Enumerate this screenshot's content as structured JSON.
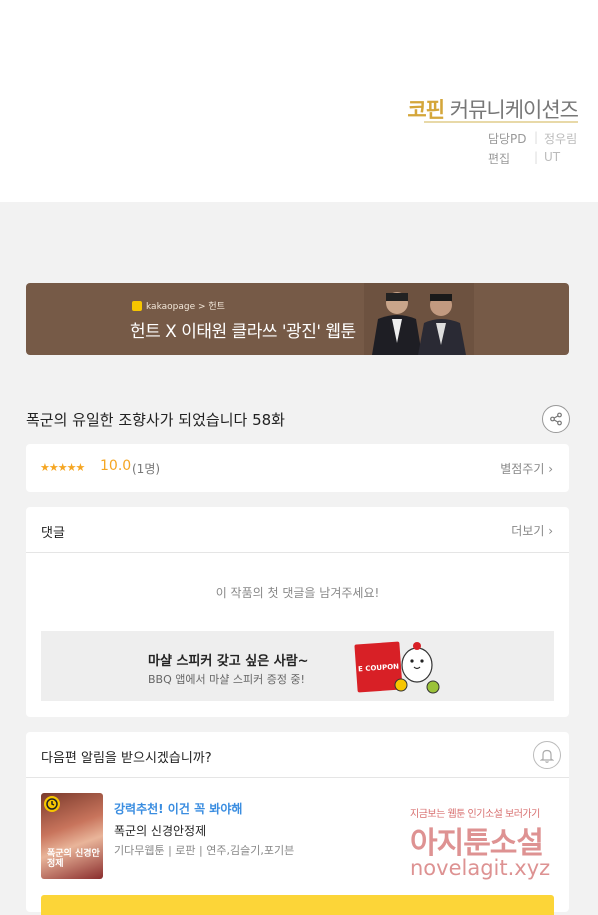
{
  "credits": {
    "studio_main": "코핀",
    "studio_rest": "커뮤니케이션즈",
    "rows": [
      {
        "role": "담당PD",
        "name": "정우림"
      },
      {
        "role": "편집",
        "name": "UT"
      }
    ]
  },
  "banner": {
    "brand": "kakaopage > 헌트",
    "title": "헌트 X 이태원 클라쓰 '광진' 웹툰"
  },
  "episode": {
    "title": "폭군의 유일한 조향사가 되었습니다 58화",
    "share_icon": "share-icon"
  },
  "rating": {
    "stars": "★★★★★",
    "score": "10.0",
    "count": "(1명)",
    "rate_button": "별점주기 ›"
  },
  "comments": {
    "header": "댓글",
    "more": "더보기 ›",
    "empty": "이 작품의 첫 댓글을 남겨주세요!"
  },
  "ad": {
    "title": "마샬 스피커 갖고 싶은 사람~",
    "subtitle": "BBQ 앱에서 마샬 스피커 증정 중!",
    "coupon": "E COUPON"
  },
  "notify": {
    "question": "다음편 알림을 받으시겠습니까?",
    "recommend_label": "강력추천! 이건 꼭 봐야해",
    "webtoon_title": "폭군의 신경안정제",
    "meta": "기다무웹툰 | 로판 | 연주,김슬기,포기븐",
    "thumb_title": "폭군의 신경안정제"
  },
  "watermark": {
    "line1": "지금보는 웹툰 인기소설 보러가기",
    "line2": "아지툰소설",
    "line3": "novelagit.xyz"
  },
  "colors": {
    "accent": "#f5a623",
    "banner": "#765a47",
    "link": "#3a8de0",
    "yellow": "#fcd538"
  }
}
